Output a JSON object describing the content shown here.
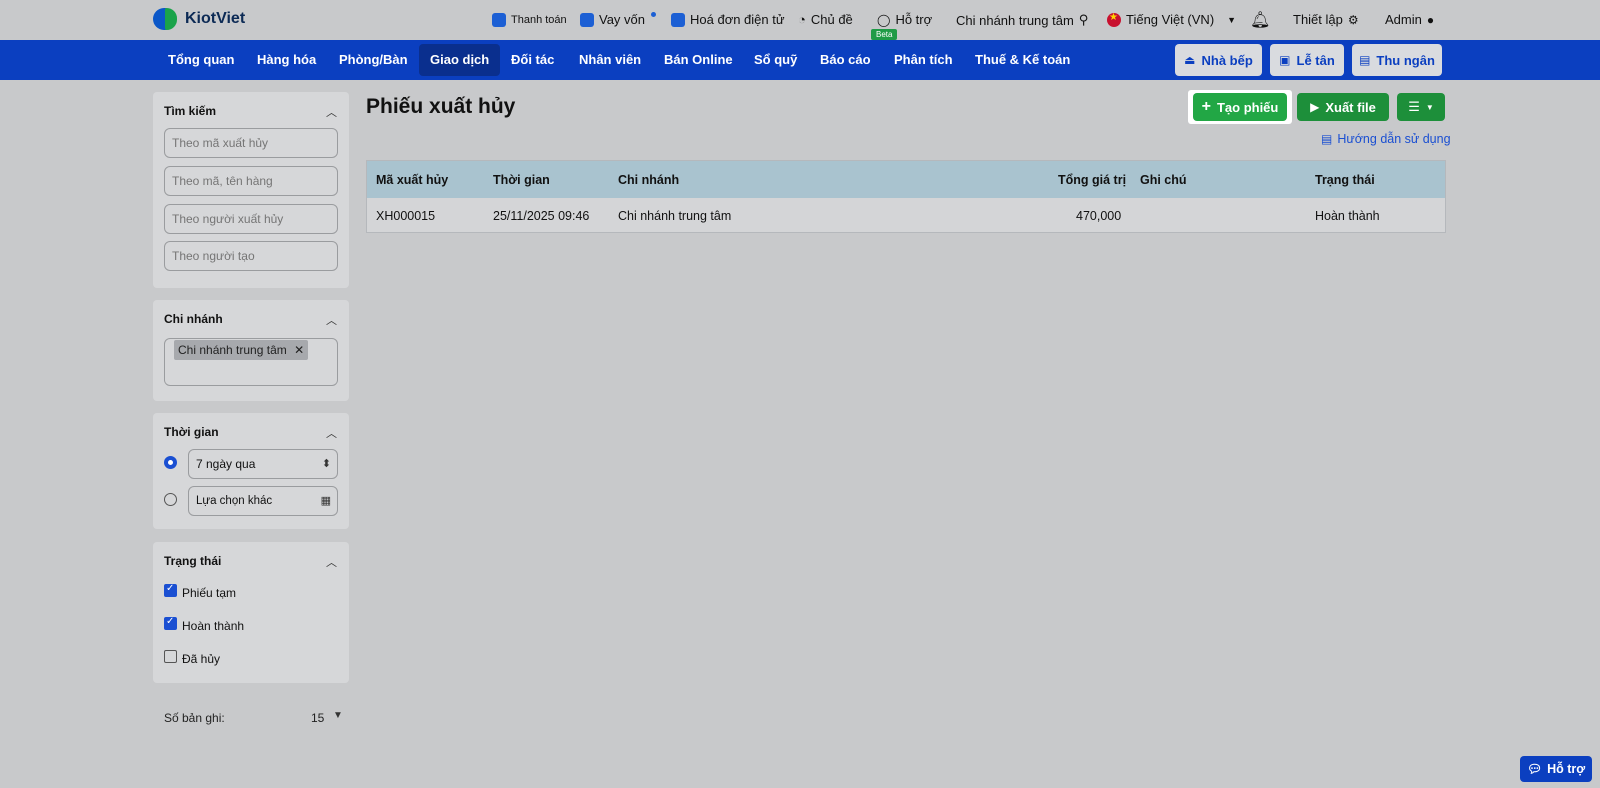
{
  "brand": {
    "name": "KiotViet"
  },
  "topbar": {
    "payment": "Thanh toán",
    "loan": "Vay vốn",
    "einvoice": "Hoá đơn điện tử",
    "theme": "Chủ đề",
    "support": "Hỗ trợ",
    "beta": "Beta",
    "branch": "Chi nhánh trung tâm",
    "language": "Tiếng Việt (VN)",
    "settings": "Thiết lập",
    "user": "Admin"
  },
  "nav": {
    "items": [
      "Tổng quan",
      "Hàng hóa",
      "Phòng/Bàn",
      "Giao dịch",
      "Đối tác",
      "Nhân viên",
      "Bán Online",
      "Sổ quỹ",
      "Báo cáo",
      "Phân tích",
      "Thuế & Kế toán"
    ],
    "active": "Giao dịch",
    "kitchen": "Nhà bếp",
    "reception": "Lễ tân",
    "cashier": "Thu ngân"
  },
  "filters": {
    "search": {
      "title": "Tìm kiếm",
      "code_placeholder": "Theo mã xuất hủy",
      "item_placeholder": "Theo mã, tên hàng",
      "person_placeholder": "Theo người xuất hủy",
      "creator_placeholder": "Theo người tạo"
    },
    "branch": {
      "title": "Chi nhánh",
      "selected": "Chi nhánh trung tâm"
    },
    "time": {
      "title": "Thời gian",
      "preset": "7 ngày qua",
      "custom": "Lựa chọn khác"
    },
    "status": {
      "title": "Trạng thái",
      "options": [
        {
          "label": "Phiếu tạm",
          "checked": true
        },
        {
          "label": "Hoàn thành",
          "checked": true
        },
        {
          "label": "Đã hủy",
          "checked": false
        }
      ]
    },
    "records": {
      "label": "Số bản ghi:",
      "value": "15"
    }
  },
  "main": {
    "title": "Phiếu xuất hủy",
    "create_button": "Tạo phiếu",
    "export_button": "Xuất file",
    "guide": "Hướng dẫn sử dụng"
  },
  "table": {
    "columns": [
      "Mã xuất hủy",
      "Thời gian",
      "Chi nhánh",
      "Tổng giá trị",
      "Ghi chú",
      "Trạng thái"
    ],
    "rows": [
      [
        "XH000015",
        "25/11/2025 09:46",
        "Chi nhánh trung tâm",
        "470,000",
        "",
        "Hoàn thành"
      ]
    ]
  },
  "help_float": "Hỗ trợ",
  "colors": {
    "nav_bg": "#0b3fc0",
    "primary_green": "#22a745",
    "link_blue": "#1a4fd2"
  }
}
